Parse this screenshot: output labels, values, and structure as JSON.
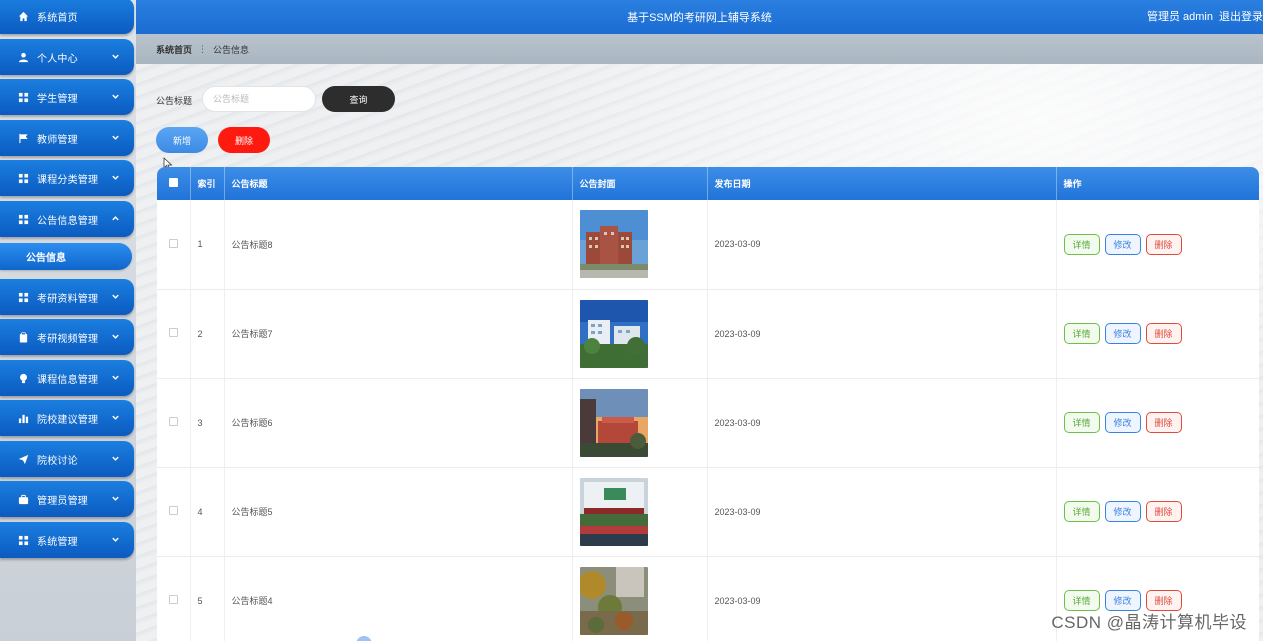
{
  "header": {
    "title": "基于SSM的考研网上辅导系统",
    "user": "管理员 admin",
    "logout": "退出登录"
  },
  "breadcrumb": {
    "home": "系统首页",
    "current": "公告信息"
  },
  "sidebar": {
    "items": [
      {
        "label": "系统首页",
        "icon": "home-icon"
      },
      {
        "label": "个人中心",
        "icon": "user-icon"
      },
      {
        "label": "学生管理",
        "icon": "grid-icon"
      },
      {
        "label": "教师管理",
        "icon": "flag-icon"
      },
      {
        "label": "课程分类管理",
        "icon": "grid-icon"
      },
      {
        "label": "公告信息管理",
        "icon": "grid-icon"
      },
      {
        "label": "考研资料管理",
        "icon": "grid-icon"
      },
      {
        "label": "考研视频管理",
        "icon": "clipboard-icon"
      },
      {
        "label": "课程信息管理",
        "icon": "bulb-icon"
      },
      {
        "label": "院校建议管理",
        "icon": "bar-chart-icon"
      },
      {
        "label": "院校讨论",
        "icon": "send-icon"
      },
      {
        "label": "管理员管理",
        "icon": "briefcase-icon"
      },
      {
        "label": "系统管理",
        "icon": "grid-icon"
      }
    ],
    "submenu": {
      "label": "公告信息"
    }
  },
  "search": {
    "label": "公告标题",
    "placeholder": "公告标题",
    "query_label": "查询"
  },
  "actions": {
    "add_label": "新增",
    "delete_label": "删除"
  },
  "table": {
    "headers": [
      "索引",
      "公告标题",
      "公告封面",
      "发布日期",
      "操作"
    ],
    "rows": [
      {
        "index": "1",
        "title": "公告标题8",
        "date": "2023-03-09"
      },
      {
        "index": "2",
        "title": "公告标题7",
        "date": "2023-03-09"
      },
      {
        "index": "3",
        "title": "公告标题6",
        "date": "2023-03-09"
      },
      {
        "index": "4",
        "title": "公告标题5",
        "date": "2023-03-09"
      },
      {
        "index": "5",
        "title": "公告标题4",
        "date": "2023-03-09"
      }
    ],
    "ops": {
      "detail": "详情",
      "edit": "修改",
      "remove": "删除"
    }
  },
  "watermark": "CSDN @晶涛计算机毕设",
  "colors": {
    "primary": "#1b6cd3",
    "danger": "#ff1a10",
    "dark_button": "#2d2d2d"
  }
}
